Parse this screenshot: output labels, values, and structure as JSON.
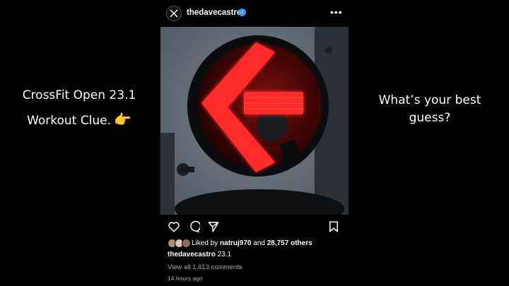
{
  "slide": {
    "left_caption_line1": "CrossFit Open 23.1",
    "left_caption_line2": "Workout Clue.",
    "pointing_emoji": "👉",
    "right_caption_line1": "What’s your best",
    "right_caption_line2": "guess?"
  },
  "post": {
    "username": "thedavecastro",
    "verified_icon": "✓",
    "more_icon": "•••",
    "image_subject": "red-left-arrow-traffic-light",
    "actions": [
      "heart-icon",
      "comment-icon",
      "share-icon",
      "bookmark-icon"
    ],
    "likes": {
      "prefix": "Liked by",
      "user": "natruj970",
      "middle": "and",
      "count": "28,757 others"
    },
    "caption": {
      "user": "thedavecastro",
      "text": "23.1"
    },
    "comments_link": "View all 1,613 comments",
    "timestamp": "14 hours ago"
  },
  "colors": {
    "background": "#000000",
    "arrow_red": "#ff2a2a",
    "verified_blue": "#3897f0",
    "muted_text": "#a8a8a8"
  }
}
